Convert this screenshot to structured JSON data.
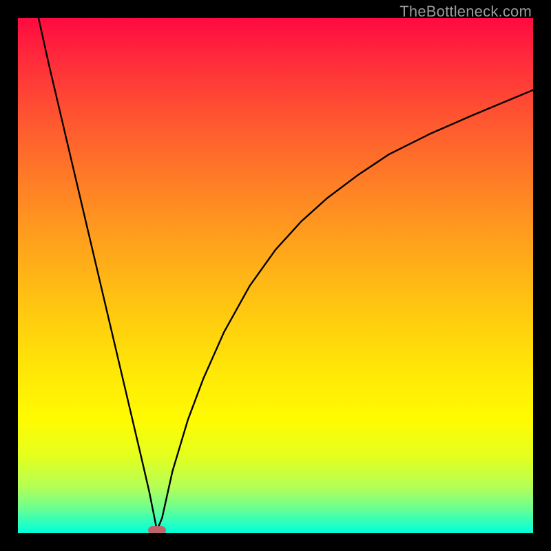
{
  "watermark": "TheBottleneck.com",
  "colors": {
    "frame": "#000000",
    "curve": "#000000",
    "marker": "#c0646a"
  },
  "chart_data": {
    "type": "line",
    "title": "",
    "xlabel": "",
    "ylabel": "",
    "xlim": [
      0,
      100
    ],
    "ylim": [
      0,
      100
    ],
    "grid": false,
    "legend": false,
    "description": "V-shaped bottleneck curve on rainbow heat gradient. Minimum bottleneck near x≈27 (y≈0). Left branch rises steeply to y=100 at x=0. Right branch rises with diminishing slope toward y≈86 at x=100.",
    "series": [
      {
        "name": "left-branch",
        "x": [
          4,
          6,
          8,
          10,
          12,
          14,
          16,
          18,
          20,
          22,
          24,
          25.5,
          26.5,
          27
        ],
        "y": [
          100,
          91,
          82.5,
          74,
          65.5,
          57,
          48.5,
          40,
          31.5,
          23,
          14.5,
          8,
          3,
          0.5
        ]
      },
      {
        "name": "right-branch",
        "x": [
          27,
          28,
          30,
          33,
          36,
          40,
          45,
          50,
          55,
          60,
          66,
          72,
          80,
          88,
          94,
          100
        ],
        "y": [
          0.5,
          3,
          12,
          22,
          30,
          39,
          48,
          55,
          60.5,
          65,
          69.5,
          73.5,
          77.5,
          81,
          83.5,
          86
        ]
      }
    ],
    "marker": {
      "x": 27,
      "y": 0.5
    },
    "gradient_stops": [
      {
        "pos": 0.0,
        "color": "#ff0a40"
      },
      {
        "pos": 0.5,
        "color": "#ffb015"
      },
      {
        "pos": 0.78,
        "color": "#fffb02"
      },
      {
        "pos": 1.0,
        "color": "#00ffd8"
      }
    ]
  }
}
